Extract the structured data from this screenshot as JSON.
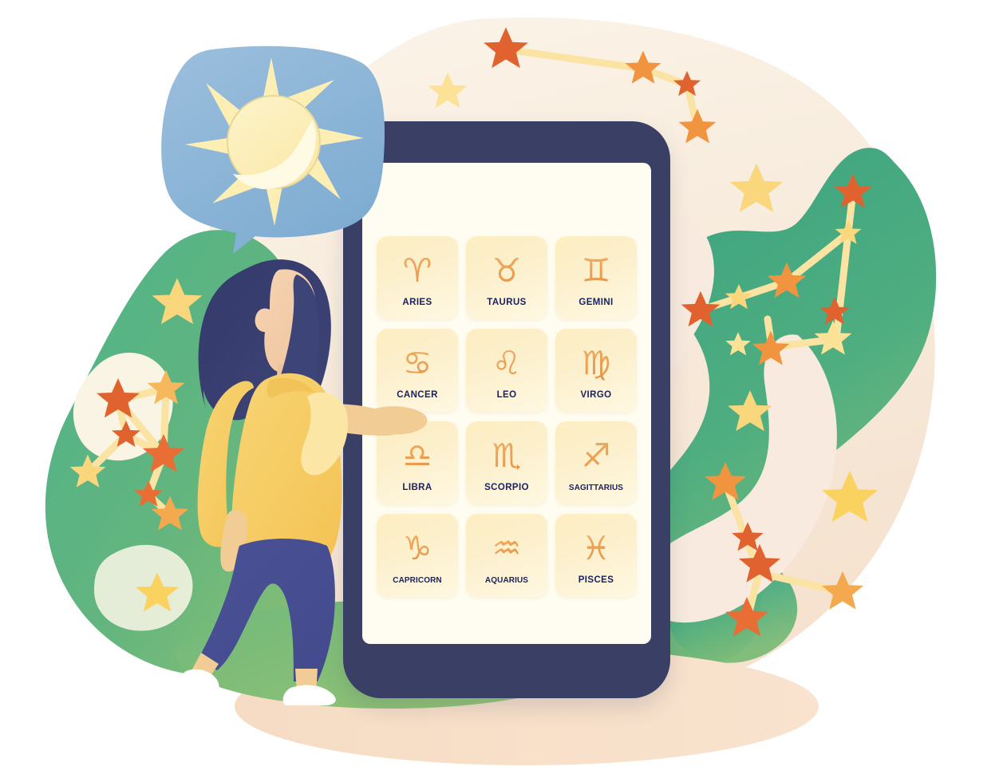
{
  "illustration": {
    "title": "Zodiac signs mobile app illustration",
    "background": {
      "canvas_color": "#ffffff",
      "blob_beige": "#f7ece0",
      "blob_cream": "#fbf7e8",
      "blob_green": "#3fa881",
      "ground_peach": "#f9ddc6"
    }
  },
  "speech_bubble": {
    "name": "sun-moon-bubble",
    "bubble_color": "#8fb6d8",
    "sun_color": "#fdf0bc",
    "ray_color": "#fdeeb4",
    "icon": "sun-moon-icon"
  },
  "character": {
    "name": "woman-pointing",
    "hair_color": "#363c6e",
    "skin_color": "#f4cfae",
    "blouse_color": "#f6cc63",
    "blouse_shadow": "#edb94b",
    "pants_color": "#4a5196",
    "shoe_color": "#ffffff"
  },
  "phone": {
    "frame_color": "#3a3f66",
    "screen_color": "#fffdf1",
    "tile_color": "#fcf0cd",
    "glyph_color": "#e8903f",
    "label_color": "#1b2260"
  },
  "zodiac": {
    "signs": [
      {
        "label": "ARIES",
        "glyph": "♈"
      },
      {
        "label": "TAURUS",
        "glyph": "♉"
      },
      {
        "label": "GEMINI",
        "glyph": "♊"
      },
      {
        "label": "CANCER",
        "glyph": "♋"
      },
      {
        "label": "LEO",
        "glyph": "♌"
      },
      {
        "label": "VIRGO",
        "glyph": "♍"
      },
      {
        "label": "LIBRA",
        "glyph": "♎"
      },
      {
        "label": "SCORPIO",
        "glyph": "♏"
      },
      {
        "label": "SAGITTARIUS",
        "glyph": "♐"
      },
      {
        "label": "CAPRICORN",
        "glyph": "♑"
      },
      {
        "label": "AQUARIUS",
        "glyph": "♒"
      },
      {
        "label": "PISCES",
        "glyph": "♓"
      }
    ]
  },
  "stars": {
    "gold": "#fad77d",
    "light_gold": "#fbe296",
    "orange": "#f0943f",
    "deep_orange": "#e0622f",
    "line_color": "#fbe3a4"
  }
}
